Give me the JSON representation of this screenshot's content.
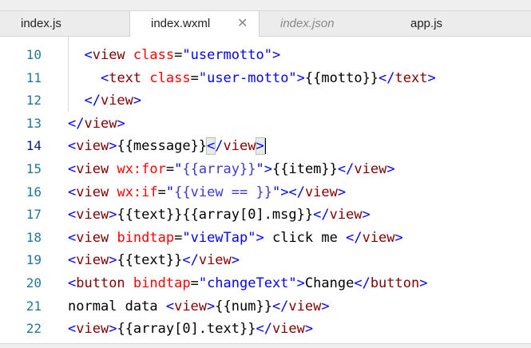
{
  "tabs": [
    {
      "label": "index.js",
      "state": "normal"
    },
    {
      "label": "index.wxml",
      "state": "active",
      "close_icon": "close-icon"
    },
    {
      "label": "index.json",
      "state": "preview"
    },
    {
      "label": "app.js",
      "state": "normal"
    }
  ],
  "editor": {
    "current_line": 14,
    "lines": [
      {
        "num": "10",
        "indent": 2,
        "tokens": [
          [
            "bracket",
            "<"
          ],
          [
            "tag",
            "view"
          ],
          [
            "text",
            " "
          ],
          [
            "attr",
            "class"
          ],
          [
            "text",
            "="
          ],
          [
            "str",
            "\"usermotto\""
          ],
          [
            "bracket",
            ">"
          ]
        ]
      },
      {
        "num": "11",
        "indent": 4,
        "tokens": [
          [
            "bracket",
            "<"
          ],
          [
            "tag",
            "text"
          ],
          [
            "text",
            " "
          ],
          [
            "attr",
            "class"
          ],
          [
            "text",
            "="
          ],
          [
            "str",
            "\"user-motto\""
          ],
          [
            "bracket",
            ">"
          ],
          [
            "text",
            "{{motto}}"
          ],
          [
            "bracket",
            "</"
          ],
          [
            "tag",
            "text"
          ],
          [
            "bracket",
            ">"
          ]
        ]
      },
      {
        "num": "12",
        "indent": 2,
        "tokens": [
          [
            "bracket",
            "</"
          ],
          [
            "tag",
            "view"
          ],
          [
            "bracket",
            ">"
          ]
        ]
      },
      {
        "num": "13",
        "indent": 0,
        "tokens": [
          [
            "bracket",
            "</"
          ],
          [
            "tag",
            "view"
          ],
          [
            "bracket",
            ">"
          ]
        ]
      },
      {
        "num": "14",
        "indent": 0,
        "tokens": [
          [
            "bracket",
            "<"
          ],
          [
            "tag",
            "view"
          ],
          [
            "bracket",
            ">"
          ],
          [
            "text",
            "{{message}}"
          ],
          [
            "bracket match",
            "<"
          ],
          [
            "bracket",
            "/"
          ],
          [
            "tag",
            "view"
          ],
          [
            "bracket match",
            ">"
          ]
        ]
      },
      {
        "num": "15",
        "indent": 0,
        "tokens": [
          [
            "bracket",
            "<"
          ],
          [
            "tag",
            "view"
          ],
          [
            "text",
            " "
          ],
          [
            "attr",
            "wx:for"
          ],
          [
            "text",
            "="
          ],
          [
            "str",
            "\""
          ],
          [
            "expr",
            "{{array}}"
          ],
          [
            "str",
            "\""
          ],
          [
            "bracket",
            ">"
          ],
          [
            "text",
            "{{item}}"
          ],
          [
            "bracket",
            "</"
          ],
          [
            "tag",
            "view"
          ],
          [
            "bracket",
            ">"
          ]
        ]
      },
      {
        "num": "16",
        "indent": 0,
        "tokens": [
          [
            "bracket",
            "<"
          ],
          [
            "tag",
            "view"
          ],
          [
            "text",
            " "
          ],
          [
            "attr",
            "wx:if"
          ],
          [
            "text",
            "="
          ],
          [
            "str",
            "\""
          ],
          [
            "expr",
            "{{view == }}"
          ],
          [
            "str",
            "\""
          ],
          [
            "bracket",
            "></"
          ],
          [
            "tag",
            "view"
          ],
          [
            "bracket",
            ">"
          ]
        ]
      },
      {
        "num": "17",
        "indent": 0,
        "tokens": [
          [
            "bracket",
            "<"
          ],
          [
            "tag",
            "view"
          ],
          [
            "bracket",
            ">"
          ],
          [
            "text",
            "{{text}}{{array[0].msg}}"
          ],
          [
            "bracket",
            "</"
          ],
          [
            "tag",
            "view"
          ],
          [
            "bracket",
            ">"
          ]
        ]
      },
      {
        "num": "18",
        "indent": 0,
        "tokens": [
          [
            "bracket",
            "<"
          ],
          [
            "tag",
            "view"
          ],
          [
            "text",
            " "
          ],
          [
            "attr",
            "bindtap"
          ],
          [
            "text",
            "="
          ],
          [
            "str",
            "\"viewTap\""
          ],
          [
            "bracket",
            ">"
          ],
          [
            "text",
            " click me "
          ],
          [
            "bracket",
            "</"
          ],
          [
            "tag",
            "view"
          ],
          [
            "bracket",
            ">"
          ]
        ]
      },
      {
        "num": "19",
        "indent": 0,
        "tokens": [
          [
            "bracket",
            "<"
          ],
          [
            "tag",
            "view"
          ],
          [
            "bracket",
            ">"
          ],
          [
            "text",
            "{{text}}"
          ],
          [
            "bracket",
            "</"
          ],
          [
            "tag",
            "view"
          ],
          [
            "bracket",
            ">"
          ]
        ]
      },
      {
        "num": "20",
        "indent": 0,
        "tokens": [
          [
            "bracket",
            "<"
          ],
          [
            "tag",
            "button"
          ],
          [
            "text",
            " "
          ],
          [
            "attr",
            "bindtap"
          ],
          [
            "text",
            "="
          ],
          [
            "str",
            "\"changeText\""
          ],
          [
            "bracket",
            ">"
          ],
          [
            "text",
            "Change"
          ],
          [
            "bracket",
            "</"
          ],
          [
            "tag",
            "button"
          ],
          [
            "bracket",
            ">"
          ]
        ]
      },
      {
        "num": "21",
        "indent": 0,
        "tokens": [
          [
            "text",
            "normal data "
          ],
          [
            "bracket",
            "<"
          ],
          [
            "tag",
            "view"
          ],
          [
            "bracket",
            ">"
          ],
          [
            "text",
            "{{num}}"
          ],
          [
            "bracket",
            "</"
          ],
          [
            "tag",
            "view"
          ],
          [
            "bracket",
            ">"
          ]
        ]
      },
      {
        "num": "22",
        "indent": 0,
        "tokens": [
          [
            "bracket",
            "<"
          ],
          [
            "tag",
            "view"
          ],
          [
            "bracket",
            ">"
          ],
          [
            "text",
            "{{array[0].text}}"
          ],
          [
            "bracket",
            "</"
          ],
          [
            "tag",
            "view"
          ],
          [
            "bracket",
            ">"
          ]
        ]
      }
    ]
  }
}
